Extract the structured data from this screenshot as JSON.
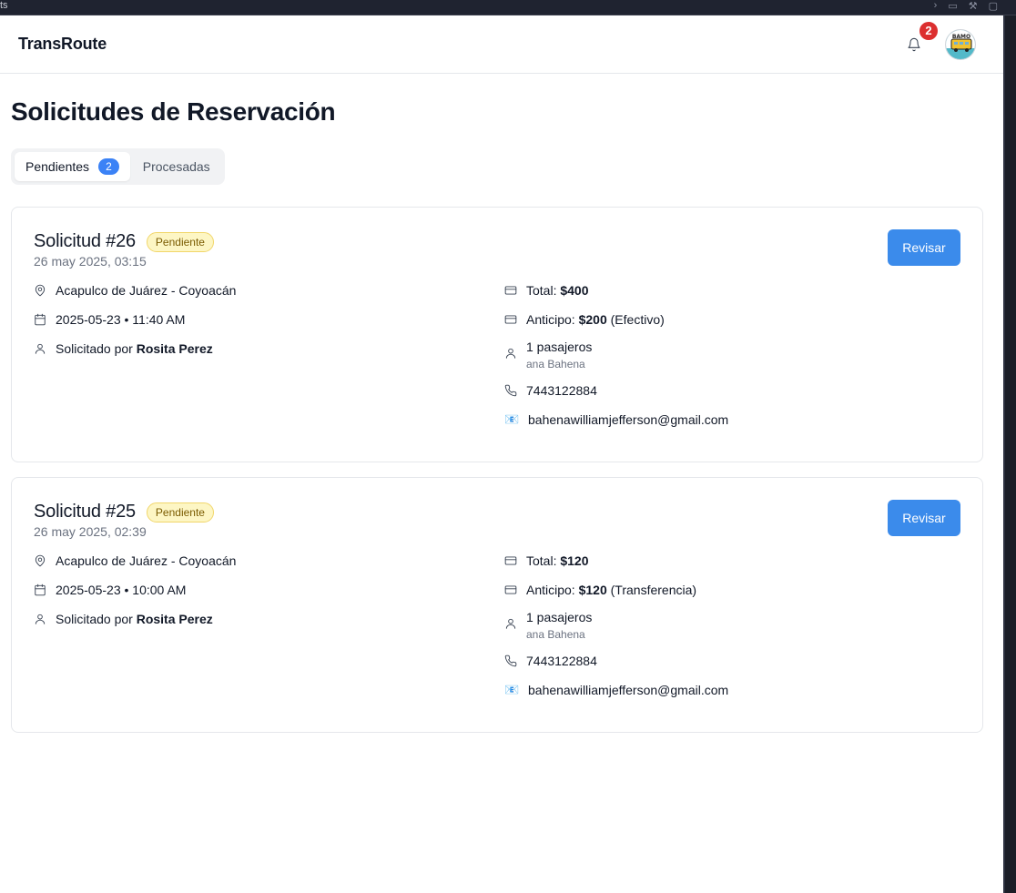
{
  "browser": {
    "tab_fragment": "ts"
  },
  "header": {
    "brand": "TransRoute",
    "notification_count": "2"
  },
  "page": {
    "title": "Solicitudes de Reservación"
  },
  "tabs": [
    {
      "label": "Pendientes",
      "count": "2"
    },
    {
      "label": "Procesadas"
    }
  ],
  "requests": [
    {
      "title": "Solicitud #26",
      "status": "Pendiente",
      "created": "26 may 2025, 03:15",
      "route": "Acapulco de Juárez - Coyoacán",
      "datetime": "2025-05-23 • 11:40 AM",
      "requested_by_prefix": "Solicitado por",
      "requested_by": "Rosita Perez",
      "total_label": "Total:",
      "total": "$400",
      "deposit_label": "Anticipo:",
      "deposit": "$200",
      "payment_method": "(Efectivo)",
      "passengers": "1 pasajeros",
      "passenger_name": "ana Bahena",
      "phone": "7443122884",
      "email": "bahenawilliamjefferson@gmail.com",
      "button": "Revisar"
    },
    {
      "title": "Solicitud #25",
      "status": "Pendiente",
      "created": "26 may 2025, 02:39",
      "route": "Acapulco de Juárez - Coyoacán",
      "datetime": "2025-05-23 • 10:00 AM",
      "requested_by_prefix": "Solicitado por",
      "requested_by": "Rosita Perez",
      "total_label": "Total:",
      "total": "$120",
      "deposit_label": "Anticipo:",
      "deposit": "$120",
      "payment_method": "(Transferencia)",
      "passengers": "1 pasajeros",
      "passenger_name": "ana Bahena",
      "phone": "7443122884",
      "email": "bahenawilliamjefferson@gmail.com",
      "button": "Revisar"
    }
  ],
  "avatar_text": "BAMO",
  "colors": {
    "primary": "#3b8beb",
    "badge_bg": "#fdf6c4",
    "notification": "#dc2f2f"
  },
  "icons": [
    "map-pin-icon",
    "calendar-icon",
    "user-icon",
    "credit-card-icon",
    "phone-icon",
    "envelope-icon",
    "bell-icon"
  ]
}
